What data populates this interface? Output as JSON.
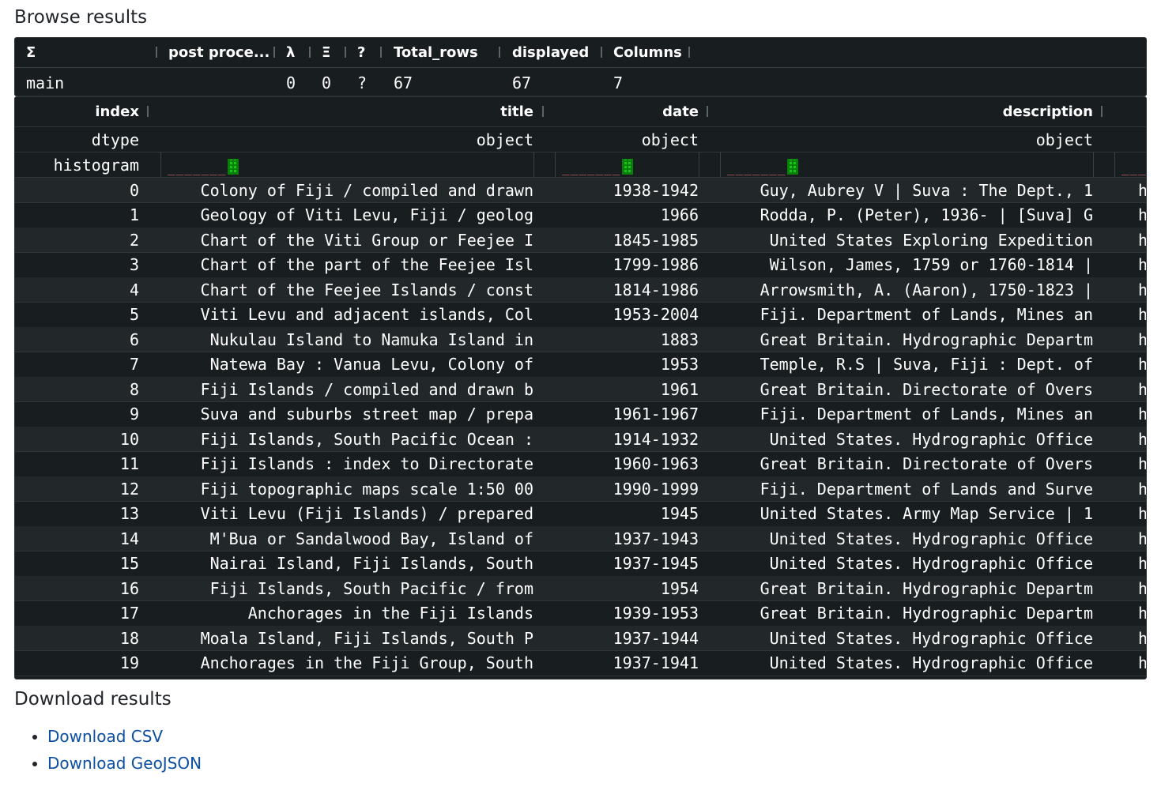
{
  "page": {
    "browse_heading": "Browse results",
    "download_heading": "Download results"
  },
  "stats": {
    "headers": [
      "Σ",
      "post proce...",
      "λ",
      "Ξ",
      "?",
      "Total_rows",
      "displayed",
      "Columns"
    ],
    "row": {
      "name": "main",
      "lambda": "0",
      "xi": "0",
      "q": "?",
      "total_rows": "67",
      "displayed": "67",
      "columns": "7"
    }
  },
  "table": {
    "headers": {
      "index": "index",
      "title": "title",
      "date": "date",
      "description": "description"
    },
    "dtype_row": {
      "label": "dtype",
      "title": "object",
      "date": "object",
      "description": "object"
    },
    "histogram_label": "histogram",
    "rows": [
      {
        "index": "0",
        "title": "Colony of Fiji / compiled and drawn",
        "date": "1938-1942",
        "description": "Guy, Aubrey V | Suva : The Dept., 1",
        "next": "h"
      },
      {
        "index": "1",
        "title": "Geology of Viti Levu, Fiji / geolog",
        "date": "1966",
        "description": "Rodda, P. (Peter), 1936- | [Suva] G",
        "next": "h"
      },
      {
        "index": "2",
        "title": "Chart of the Viti Group or Feejee I",
        "date": "1845-1985",
        "description": "United States Exploring Expedition ",
        "next": "h"
      },
      {
        "index": "3",
        "title": "Chart of the part of the Feejee Isl",
        "date": "1799-1986",
        "description": "Wilson, James, 1759 or 1760-1814 | ",
        "next": "h"
      },
      {
        "index": "4",
        "title": "Chart of the Feejee Islands / const",
        "date": "1814-1986",
        "description": "Arrowsmith, A. (Aaron), 1750-1823 | ",
        "next": "h"
      },
      {
        "index": "5",
        "title": "Viti Levu and adjacent islands, Col",
        "date": "1953-2004",
        "description": "Fiji. Department of Lands, Mines an",
        "next": "h"
      },
      {
        "index": "6",
        "title": "Nukulau Island to Namuka Island  in",
        "date": "1883",
        "description": "Great Britain. Hydrographic Departm",
        "next": "h"
      },
      {
        "index": "7",
        "title": "Natewa Bay : Vanua Levu, Colony of ",
        "date": "1953",
        "description": "Temple, R.S | Suva, Fiji : Dept. of",
        "next": "h"
      },
      {
        "index": "8",
        "title": "Fiji Islands / compiled and drawn b",
        "date": "1961",
        "description": "Great Britain. Directorate of Overs",
        "next": "h"
      },
      {
        "index": "9",
        "title": "Suva and suburbs street map / prepa",
        "date": "1961-1967",
        "description": "Fiji. Department of Lands, Mines an",
        "next": "h"
      },
      {
        "index": "10",
        "title": "Fiji Islands, South Pacific Ocean : ",
        "date": "1914-1932",
        "description": "United States. Hydrographic Office ",
        "next": "h"
      },
      {
        "index": "11",
        "title": "Fiji Islands : index to Directorate",
        "date": "1960-1963",
        "description": "Great Britain. Directorate of Overs",
        "next": "h"
      },
      {
        "index": "12",
        "title": "Fiji topographic maps scale 1:50 00",
        "date": "1990-1999",
        "description": "Fiji. Department of Lands and Surve",
        "next": "h"
      },
      {
        "index": "13",
        "title": "Viti Levu (Fiji Islands) / prepared",
        "date": "1945",
        "description": "United States. Army Map Service | 1",
        "next": "h"
      },
      {
        "index": "14",
        "title": "M'Bua or Sandalwood Bay, Island of ",
        "date": "1937-1943",
        "description": "United States. Hydrographic Office ",
        "next": "h"
      },
      {
        "index": "15",
        "title": "Nairai Island, Fiji Islands, South ",
        "date": "1937-1945",
        "description": "United States. Hydrographic Office ",
        "next": "h"
      },
      {
        "index": "16",
        "title": "Fiji Islands, South Pacific / from ",
        "date": "1954",
        "description": "Great Britain. Hydrographic Departm",
        "next": "h"
      },
      {
        "index": "17",
        "title": "Anchorages in the Fiji Islands",
        "date": "1939-1953",
        "description": "Great Britain. Hydrographic Departm",
        "next": "h"
      },
      {
        "index": "18",
        "title": "Moala Island, Fiji Islands, South P",
        "date": "1937-1944",
        "description": "United States. Hydrographic Office ",
        "next": "h"
      },
      {
        "index": "19",
        "title": "Anchorages in the Fiji Group, South",
        "date": "1937-1941",
        "description": "United States. Hydrographic Office ",
        "next": "h"
      }
    ]
  },
  "downloads": [
    {
      "label": "Download CSV"
    },
    {
      "label": "Download GeoJSON"
    }
  ],
  "colors": {
    "panel_bg": "#181d1f",
    "alt_row_bg": "#222729",
    "histogram_bar": "#19c519",
    "histogram_dash": "#e06c75",
    "link": "#0b4ea2"
  }
}
